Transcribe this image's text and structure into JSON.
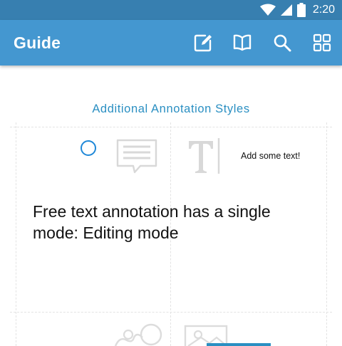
{
  "status_bar": {
    "time": "2:20"
  },
  "app_bar": {
    "title": "Guide",
    "icons": [
      "edit-icon",
      "book-icon",
      "search-icon",
      "grid-icon"
    ]
  },
  "main": {
    "section_title": "Additional Annotation Styles",
    "sample_annotation_text": "Add some text!",
    "description": "Free text annotation has a single mode: Editing mode"
  },
  "colors": {
    "status_bar": "#377fb0",
    "app_bar": "#4497d0",
    "accent": "#2a8fc2",
    "circle": "#1f88d8"
  }
}
